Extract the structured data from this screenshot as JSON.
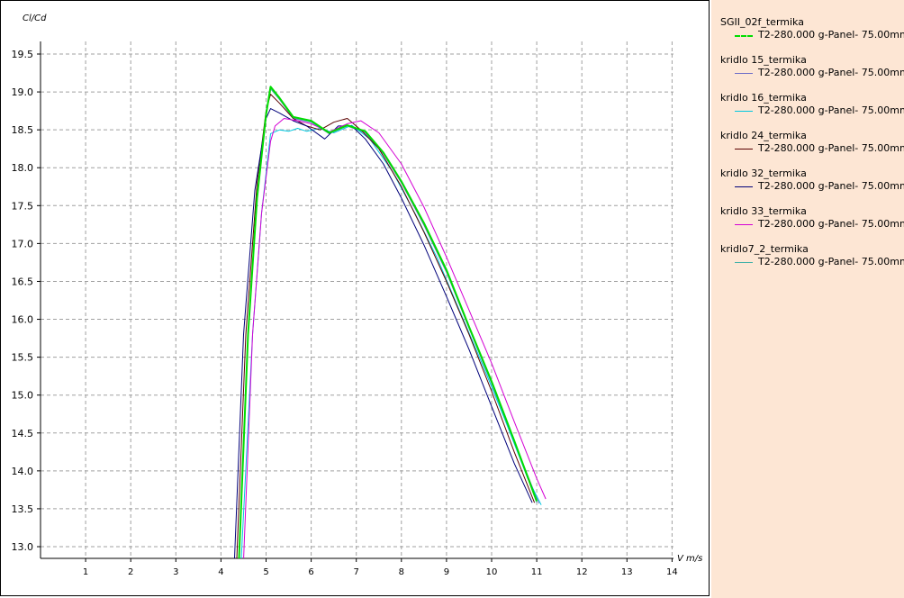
{
  "chart_data": {
    "type": "line",
    "xlabel": "V m/s",
    "ylabel": "Cl/Cd",
    "xlim": [
      0,
      14.6
    ],
    "ylim": [
      12.82,
      19.9
    ],
    "x_ticks": [
      "1",
      "2",
      "3",
      "4",
      "5",
      "6",
      "7",
      "8",
      "9",
      "10",
      "11",
      "12",
      "13",
      "14"
    ],
    "y_ticks": [
      "13.0",
      "13.5",
      "14.0",
      "14.5",
      "15.0",
      "15.5",
      "16.0",
      "16.5",
      "17.0",
      "17.5",
      "18.0",
      "18.5",
      "19.0",
      "19.5"
    ],
    "grid": true,
    "legend_position": "right",
    "series": [
      {
        "name": "SGII_02f_termika",
        "label": "T2-280.000 g-Panel- 75.00mm",
        "color": "#00dd00",
        "dashed": true,
        "x": [
          4.4,
          4.6,
          4.8,
          5.0,
          5.1,
          5.3,
          5.6,
          6.0,
          6.4,
          6.8,
          7.2,
          7.6,
          8.0,
          8.5,
          9.0,
          9.5,
          10.0,
          10.5,
          11.0
        ],
        "y": [
          12.82,
          15.8,
          17.6,
          18.7,
          19.07,
          18.92,
          18.67,
          18.62,
          18.46,
          18.56,
          18.48,
          18.2,
          17.82,
          17.27,
          16.65,
          15.9,
          15.18,
          14.4,
          13.6
        ]
      },
      {
        "name": "kridlo 15_termika",
        "label": "T2-280.000 g-Panel- 75.00mm",
        "color": "#6b6bc8",
        "dashed": false,
        "x": [
          4.4,
          4.6,
          4.8,
          5.0,
          5.1,
          5.3,
          5.6,
          6.0,
          6.4,
          6.8,
          7.2,
          7.6,
          8.0,
          8.5,
          9.0,
          9.5,
          10.0,
          10.5,
          11.05
        ],
        "y": [
          12.82,
          15.8,
          17.6,
          18.7,
          19.05,
          18.9,
          18.65,
          18.6,
          18.45,
          18.55,
          18.46,
          18.18,
          17.8,
          17.24,
          16.62,
          15.88,
          15.15,
          14.38,
          13.57
        ]
      },
      {
        "name": "kridlo 16_termika",
        "label": "T2-280.000 g-Panel- 75.00mm",
        "color": "#00c8e0",
        "dashed": false,
        "x": [
          4.45,
          4.7,
          4.9,
          5.1,
          5.3,
          5.5,
          5.7,
          5.9,
          6.2,
          6.5,
          6.9,
          7.3,
          7.8,
          8.3,
          8.8,
          9.3,
          9.8,
          10.3,
          10.8,
          11.1
        ],
        "y": [
          12.82,
          15.8,
          17.4,
          18.45,
          18.5,
          18.48,
          18.52,
          18.48,
          18.52,
          18.46,
          18.56,
          18.38,
          17.95,
          17.4,
          16.8,
          16.1,
          15.4,
          14.67,
          13.9,
          13.55
        ]
      },
      {
        "name": "kridlo 24_termika",
        "label": "T2-280.000 g-Panel- 75.00mm",
        "color": "#5a0000",
        "dashed": false,
        "x": [
          4.35,
          4.55,
          4.8,
          5.0,
          5.1,
          5.3,
          5.6,
          5.9,
          6.2,
          6.5,
          6.8,
          7.1,
          7.5,
          8.0,
          8.5,
          9.0,
          9.5,
          10.0,
          10.5,
          10.95
        ],
        "y": [
          12.82,
          15.8,
          17.8,
          18.75,
          18.97,
          18.85,
          18.65,
          18.55,
          18.5,
          18.6,
          18.65,
          18.5,
          18.25,
          17.75,
          17.15,
          16.5,
          15.8,
          15.05,
          14.25,
          13.58
        ]
      },
      {
        "name": "kridlo 32_termika",
        "label": "T2-280.000 g-Panel- 75.00mm",
        "color": "#00007a",
        "dashed": false,
        "x": [
          4.3,
          4.5,
          4.75,
          5.0,
          5.1,
          5.3,
          5.6,
          5.9,
          6.3,
          6.6,
          6.9,
          7.2,
          7.6,
          8.0,
          8.5,
          9.0,
          9.5,
          10.0,
          10.5,
          10.9
        ],
        "y": [
          12.82,
          15.8,
          17.7,
          18.65,
          18.78,
          18.72,
          18.62,
          18.55,
          18.38,
          18.55,
          18.55,
          18.38,
          18.05,
          17.6,
          16.98,
          16.3,
          15.6,
          14.85,
          14.1,
          13.58
        ]
      },
      {
        "name": "kridlo 33_termika",
        "label": "T2-280.000 g-Panel- 75.00mm",
        "color": "#d400d4",
        "dashed": false,
        "x": [
          4.5,
          4.7,
          4.9,
          5.1,
          5.2,
          5.4,
          5.7,
          6.0,
          6.4,
          6.8,
          7.1,
          7.5,
          8.0,
          8.5,
          9.0,
          9.5,
          10.0,
          10.5,
          11.0,
          11.2
        ],
        "y": [
          12.82,
          15.8,
          17.4,
          18.35,
          18.55,
          18.65,
          18.62,
          18.58,
          18.47,
          18.58,
          18.62,
          18.46,
          18.05,
          17.48,
          16.82,
          16.12,
          15.42,
          14.65,
          13.9,
          13.63
        ]
      },
      {
        "name": "kridlo7_2_termika",
        "label": "T2-280.000 g-Panel- 75.00mm",
        "color": "#40b0a8",
        "dashed": false,
        "x": [
          4.4,
          4.6,
          4.8,
          5.0,
          5.1,
          5.3,
          5.6,
          6.0,
          6.4,
          6.8,
          7.2,
          7.6,
          8.0,
          8.5,
          9.0,
          9.5,
          10.0,
          10.5,
          11.0
        ],
        "y": [
          12.82,
          15.8,
          17.6,
          18.7,
          19.04,
          18.9,
          18.66,
          18.6,
          18.46,
          18.55,
          18.48,
          18.2,
          17.82,
          17.26,
          16.63,
          15.89,
          15.16,
          14.39,
          13.58
        ]
      }
    ]
  }
}
